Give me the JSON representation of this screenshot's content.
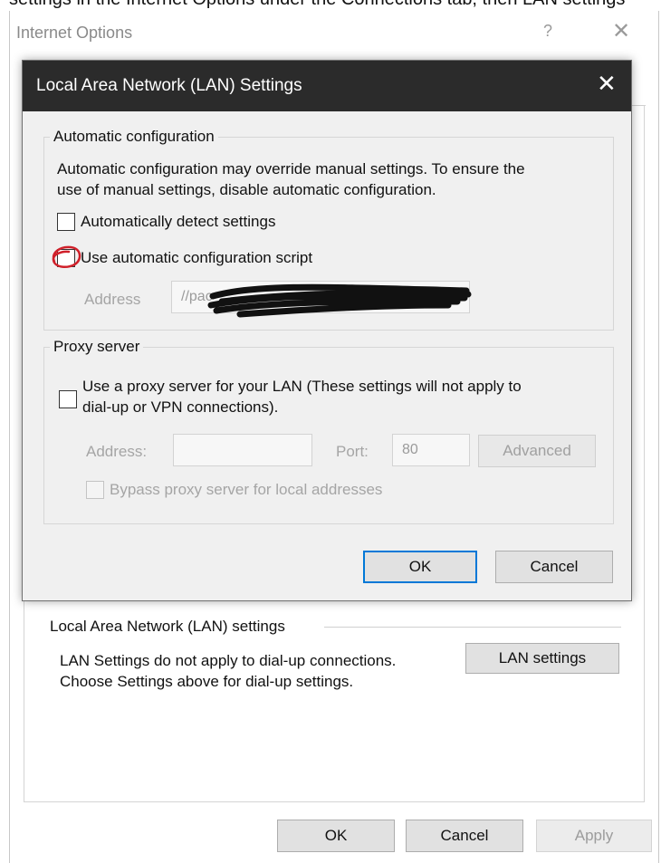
{
  "top_crop_text": "settings in the Internet Options under the Connections tab, then LAN settings",
  "internet_options": {
    "title": "Internet Options",
    "help_glyph": "?",
    "close_glyph": "✕",
    "lan_group_label": "Local Area Network (LAN) settings",
    "lan_desc_line1": "LAN Settings do not apply to dial-up connections.",
    "lan_desc_line2": "Choose Settings above for dial-up settings.",
    "lan_settings_button": "LAN settings",
    "ok_button": "OK",
    "cancel_button": "Cancel",
    "apply_button": "Apply"
  },
  "lan_dialog": {
    "title": "Local Area Network (LAN) Settings",
    "close_glyph": "✕",
    "automatic_configuration": {
      "legend": "Automatic configuration",
      "description_line1": "Automatic configuration may override manual settings.  To ensure the",
      "description_line2": "use of manual settings, disable automatic configuration.",
      "auto_detect_label": "Automatically detect settings",
      "auto_detect_checked": false,
      "use_script_label": "Use automatic configuration script",
      "use_script_checked": false,
      "address_label": "Address",
      "address_value": "//pac"
    },
    "proxy_server": {
      "legend": "Proxy server",
      "use_proxy_label_line1": "Use a proxy server for your LAN (These settings will not apply to",
      "use_proxy_label_line2": "dial-up or VPN connections).",
      "use_proxy_checked": false,
      "address_label": "Address:",
      "address_value": "",
      "port_label": "Port:",
      "port_value": "80",
      "advanced_button": "Advanced",
      "bypass_label": "Bypass proxy server for local addresses",
      "bypass_checked": false
    },
    "ok_button": "OK",
    "cancel_button": "Cancel"
  },
  "colors": {
    "title_bar": "#2b2b2b",
    "dialog_bg": "#f0f0f0",
    "default_button_border": "#0078d7",
    "annotation_red": "#d0202a",
    "redaction": "#111111"
  }
}
